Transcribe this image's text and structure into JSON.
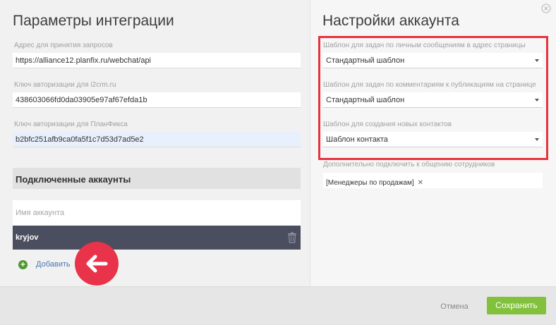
{
  "integration": {
    "title": "Параметры интеграции",
    "fields": [
      {
        "label": "Адрес для принятия запросов",
        "value": "https://alliance12.planfix.ru/webchat/api"
      },
      {
        "label": "Ключ авторизации для i2crm.ru",
        "value": "438603066fd0da03905e97af67efda1b"
      },
      {
        "label": "Ключ авторизации для ПланФикса",
        "value": "b2bfc251afb9ca0fa5f1c7d53d7ad5e2"
      }
    ]
  },
  "accounts": {
    "header": "Подключенные аккаунты",
    "name_placeholder": "Имя аккаунта",
    "items": [
      {
        "name": "kryjov"
      }
    ],
    "add_label": "Добавить"
  },
  "account_settings": {
    "title": "Настройки аккаунта",
    "templates": [
      {
        "label": "Шаблон для задач по личным сообщениям в адрес страницы",
        "value": "Стандартный шаблон"
      },
      {
        "label": "Шаблон для задач по комментариям к публикациям на странице",
        "value": "Стандартный шаблон"
      },
      {
        "label": "Шаблон для создания новых контактов",
        "value": "Шаблон контакта"
      }
    ],
    "extra_label": "Дополнительно подключить к общению сотрудников",
    "extra_tags": [
      "[Менеджеры по продажам]"
    ]
  },
  "footer": {
    "cancel_label": "Отмена",
    "save_label": "Сохранить"
  },
  "colors": {
    "highlight_frame": "#e8323f",
    "save_button": "#82c13b",
    "account_row": "#4b4e5f",
    "arrow_badge": "#e9334a"
  }
}
